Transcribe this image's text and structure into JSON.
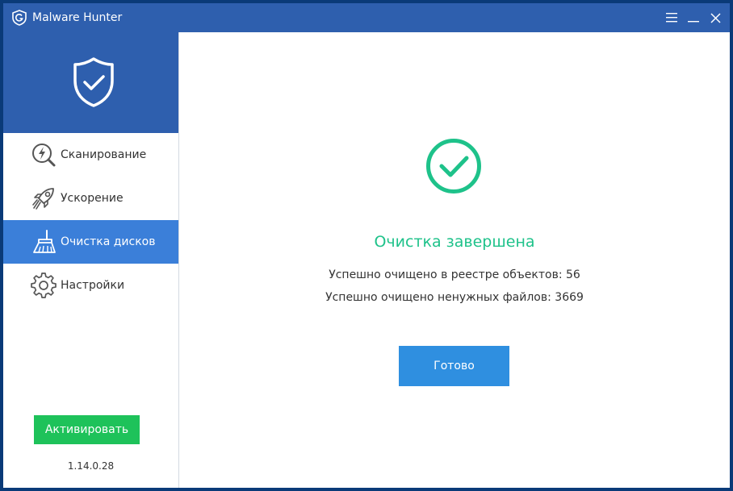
{
  "window": {
    "title": "Malware Hunter",
    "icons": {
      "logo": "g-shield-logo-icon",
      "menu": "hamburger-menu-icon",
      "minimize": "minimize-icon",
      "close": "close-icon"
    }
  },
  "sidebar": {
    "header_icon": "shield-check-icon",
    "items": [
      {
        "label": "Сканирование",
        "icon": "scan-lightning-icon",
        "active": false
      },
      {
        "label": "Ускорение",
        "icon": "rocket-icon",
        "active": false
      },
      {
        "label": "Очистка дисков",
        "icon": "broom-icon",
        "active": true
      },
      {
        "label": "Настройки",
        "icon": "gear-icon",
        "active": false
      }
    ],
    "activate_label": "Активировать",
    "version": "1.14.0.28"
  },
  "main": {
    "status_icon": "check-circle-icon",
    "title": "Очистка завершена",
    "registry_line": "Успешно очищено в реестре объектов: 56",
    "files_line": "Успешно очищено ненужных файлов: 3669",
    "done_label": "Готово"
  },
  "colors": {
    "brand_blue": "#2e5fae",
    "active_nav": "#3b7fd9",
    "success_green": "#1ec28a",
    "activate_green": "#1ec25a",
    "button_blue": "#2f8fe0"
  }
}
